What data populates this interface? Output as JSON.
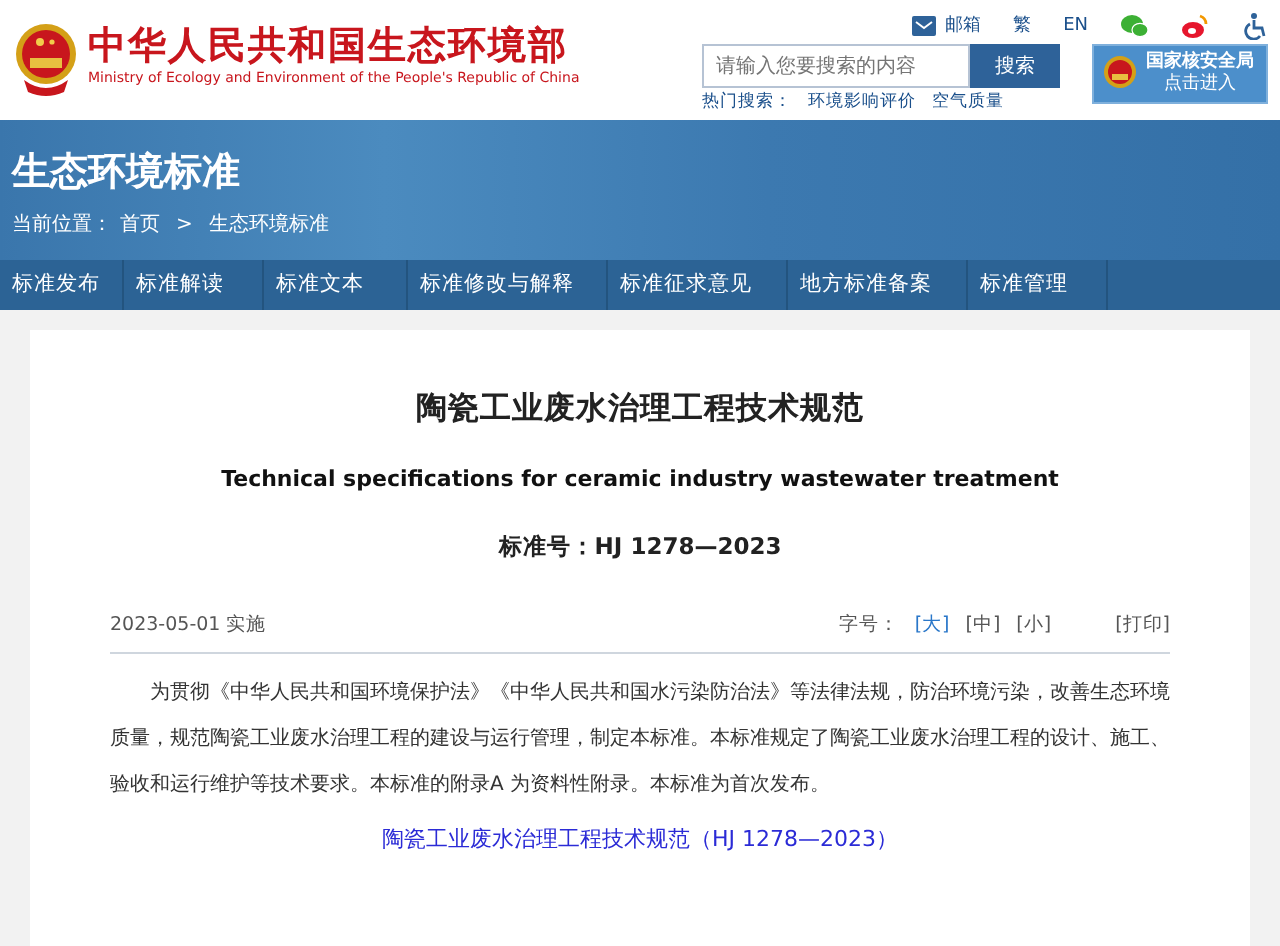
{
  "header": {
    "title": "中华人民共和国生态环境部",
    "subtitle": "Ministry of Ecology and Environment of the People's Republic of China",
    "links": [
      {
        "kind": "mail",
        "label": "邮箱"
      },
      {
        "kind": "text",
        "label": "繁"
      },
      {
        "kind": "text",
        "label": "EN"
      },
      {
        "kind": "wechat"
      },
      {
        "kind": "weibo"
      },
      {
        "kind": "access"
      }
    ],
    "search": {
      "placeholder": "请输入您要搜索的内容",
      "button": "搜索"
    },
    "hot": {
      "label": "热门搜索：",
      "items": [
        "环境影响评价",
        "空气质量"
      ]
    },
    "badge": {
      "title": "国家核安全局",
      "action": "点击进入"
    }
  },
  "banner": {
    "title": "生态环境标准",
    "breadcrumb": {
      "label": "当前位置：",
      "items": [
        "首页",
        "生态环境标准"
      ],
      "separator": ">"
    }
  },
  "nav": [
    {
      "label": "标准发布"
    },
    {
      "label": "标准解读"
    },
    {
      "label": "标准文本"
    },
    {
      "label": "标准修改与解释"
    },
    {
      "label": "标准征求意见"
    },
    {
      "label": "地方标准备案"
    },
    {
      "label": "标准管理"
    }
  ],
  "article": {
    "title": "陶瓷工业废水治理工程技术规范",
    "subtitle": "Technical specifications for ceramic industry wastewater treatment",
    "number": "标准号：HJ 1278—2023",
    "date": "2023-05-01 实施",
    "font_size": {
      "label": "字号：",
      "options": [
        {
          "label": "[大]",
          "selected": true
        },
        {
          "label": "[中]",
          "selected": false
        },
        {
          "label": "[小]",
          "selected": false
        }
      ]
    },
    "print": "[打印]",
    "body": "为贯彻《中华人民共和国环境保护法》《中华人民共和国水污染防治法》等法律法规，防治环境污染，改善生态环境质量，规范陶瓷工业废水治理工程的建设与运行管理，制定本标准。本标准规定了陶瓷工业废水治理工程的设计、施工、验收和运行维护等技术要求。本标准的附录A 为资料性附录。本标准为首次发布。",
    "link": "陶瓷工业废水治理工程技术规范（HJ 1278—2023）"
  }
}
